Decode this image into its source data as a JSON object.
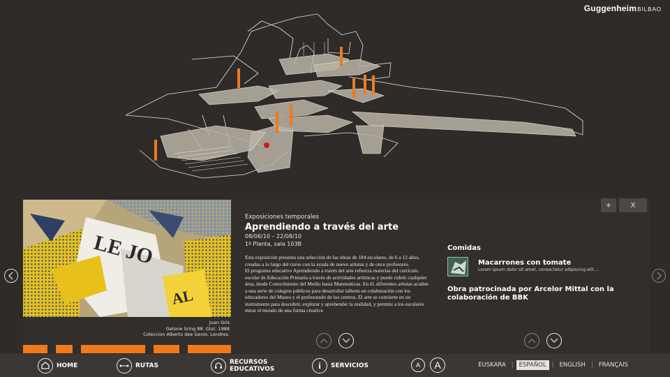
{
  "brand": {
    "name": "Guggenheim",
    "sub": "BILBAO"
  },
  "exhibition": {
    "category": "Exposiciones temporales",
    "title": "Aprendiendo a través del arte",
    "dates": "08/06/10 – 22/08/10",
    "location": "1ª Planta, sala 103B",
    "paragraphs": [
      "Esta exposición presenta una selección de las obras de 184 escolares, de 6 a 12 años, creadas a lo largo del curso con la ayuda de nueve artistas y de once profesores.",
      "El programa educativo Aprendiendo a través del arte refuerza materias del currículo escolar de Educación Primaria a través de actividades artísticas y puede cubrir cualquier área, desde Conocimiento del Medio hasta Matemáticas. En él, diferentes artistas acuden a una serie de colegios públicos para desarrollar talleres en colaboración con los educadores del Museo y el profesorado de los centros. El arte se convierte en un instrumento para descubrir, explorar y aprehender la realidad, y permite a los escolares mirar el mundo de una forma creativa"
    ]
  },
  "artwork": {
    "artist": "Juan Gris",
    "title": "Getone Sring 88. Glut. 1988",
    "collection": "Coleccion Alberto dee Genio. Londres.",
    "text": "LE JO"
  },
  "side": {
    "plus_label": "+",
    "close_label": "X",
    "section": "Comidas",
    "food_name": "Macarrones con tomate",
    "food_desc": "Lorem ipsum dolor sit amet, consectetur adipiscing elit....",
    "sponsor": "Obra patrocinada por Arcelor Mittal con la colaboración de BBK"
  },
  "nav": {
    "home": "HOME",
    "rutas": "RUTAS",
    "recursos_1": "RECURSOS",
    "recursos_2": "EDUCATIVOS",
    "servicios": "SERVICIOS",
    "font_small": "A",
    "font_large": "A"
  },
  "languages": {
    "euskara": "EUSKARA",
    "espanol": "ESPAÑOL",
    "english": "ENGLISH",
    "francais": "FRANÇAIS",
    "selected": "ESPAÑOL"
  },
  "colors": {
    "accent": "#f07a1b",
    "background": "#2e2b29",
    "navbar": "#3a3734"
  }
}
